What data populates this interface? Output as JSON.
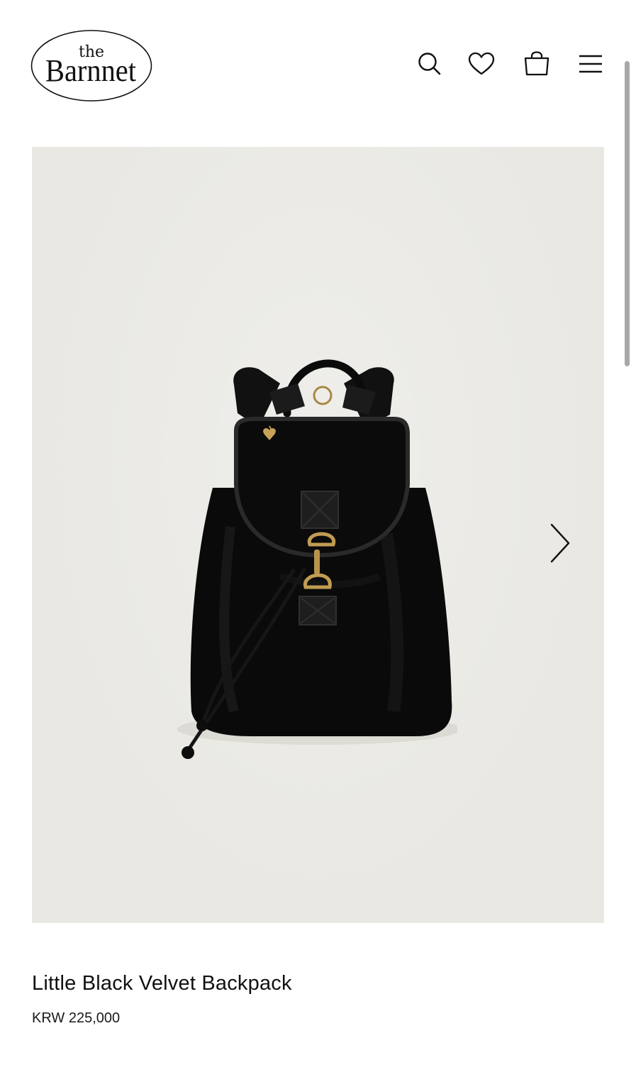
{
  "brand": {
    "logo_top": "the",
    "logo_main": "Barnnet"
  },
  "header": {
    "icons": [
      "search-icon",
      "heart-icon",
      "shopping-bag-icon",
      "hamburger-menu-icon"
    ]
  },
  "gallery": {
    "next_icon": "chevron-right-icon",
    "background_color": "#e9e8e3"
  },
  "product": {
    "title": "Little Black Velvet Backpack",
    "price": "KRW 225,000"
  },
  "colors": {
    "text": "#111111",
    "background": "#ffffff"
  }
}
